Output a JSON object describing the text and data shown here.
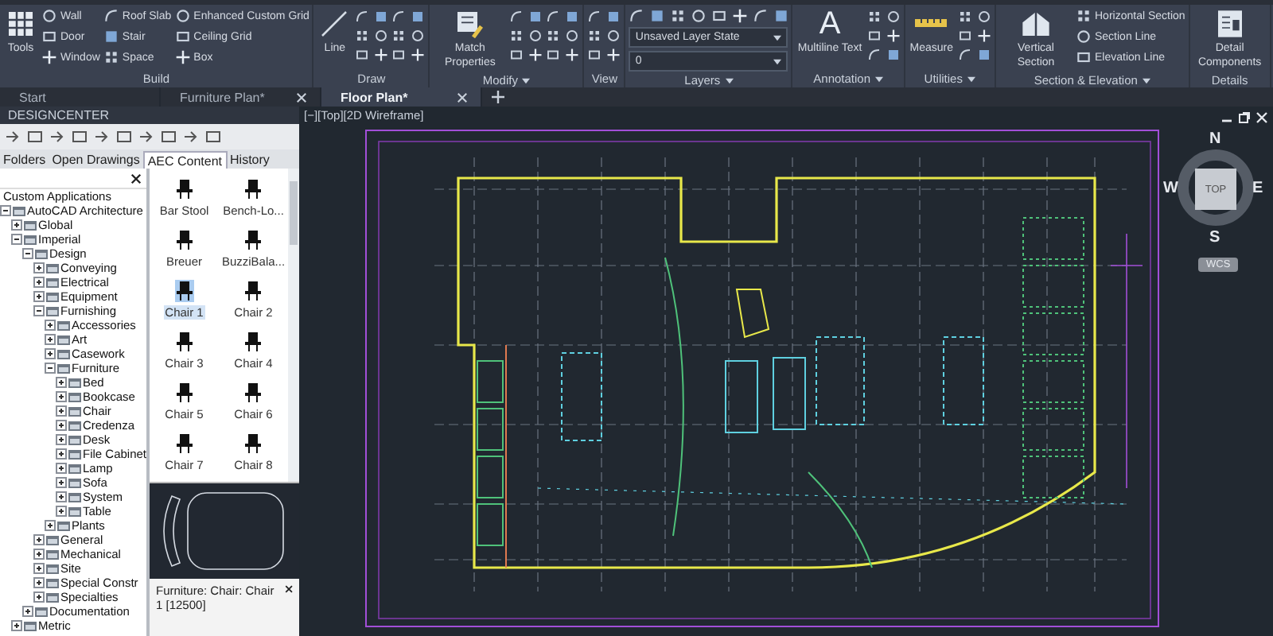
{
  "ribbon": {
    "panels": [
      {
        "title": "Build",
        "dropdown": false,
        "columns": [
          {
            "kind": "large",
            "label": "Tools"
          },
          {
            "kind": "list",
            "items": [
              "Wall",
              "Door",
              "Window"
            ]
          },
          {
            "kind": "list",
            "items": [
              "Roof Slab",
              "Stair",
              "Space"
            ]
          },
          {
            "kind": "list",
            "items": [
              "Enhanced Custom Grid",
              "Ceiling Grid",
              "Box"
            ]
          }
        ]
      },
      {
        "title": "Draw",
        "dropdown": false,
        "columns": [
          {
            "kind": "large",
            "label": "Line"
          },
          {
            "kind": "icons"
          },
          {
            "kind": "icons"
          }
        ]
      },
      {
        "title": "Modify",
        "dropdown": true,
        "columns": [
          {
            "kind": "large",
            "label": "Match Properties"
          },
          {
            "kind": "icons"
          },
          {
            "kind": "icons"
          }
        ]
      },
      {
        "title": "View",
        "dropdown": false,
        "columns": [
          {
            "kind": "icons"
          }
        ]
      },
      {
        "title": "Layers",
        "dropdown": true,
        "columns": [
          {
            "kind": "layers",
            "state": "Unsaved Layer State",
            "layer": "0"
          }
        ]
      },
      {
        "title": "Annotation",
        "dropdown": true,
        "columns": [
          {
            "kind": "large",
            "label": "Multiline Text",
            "glyph": "A"
          },
          {
            "kind": "icons"
          }
        ]
      },
      {
        "title": "Utilities",
        "dropdown": true,
        "columns": [
          {
            "kind": "large",
            "label": "Measure"
          },
          {
            "kind": "icons"
          }
        ]
      },
      {
        "title": "Section & Elevation",
        "dropdown": true,
        "columns": [
          {
            "kind": "large",
            "label": "Vertical Section"
          },
          {
            "kind": "list",
            "items": [
              "Horizontal Section",
              "Section Line",
              "Elevation Line"
            ]
          }
        ]
      },
      {
        "title": "Details",
        "dropdown": false,
        "columns": [
          {
            "kind": "large",
            "label": "Detail Components"
          }
        ]
      }
    ]
  },
  "file_tabs": [
    {
      "label": "Start",
      "selected": false,
      "closable": false
    },
    {
      "label": "Furniture Plan*",
      "selected": false,
      "closable": true
    },
    {
      "label": "Floor Plan*",
      "selected": true,
      "closable": true
    }
  ],
  "designcenter": {
    "title": "DESIGNCENTER",
    "tabs": [
      {
        "label": "Folders",
        "selected": false
      },
      {
        "label": "Open Drawings",
        "selected": false
      },
      {
        "label": "AEC Content",
        "selected": true
      },
      {
        "label": "History",
        "selected": false
      }
    ],
    "tree": {
      "title": "Custom Applications",
      "nodes": [
        {
          "label": "AutoCAD Architecture",
          "expanded": true,
          "children": [
            {
              "label": "Global",
              "expanded": false
            },
            {
              "label": "Imperial",
              "expanded": true,
              "children": [
                {
                  "label": "Design",
                  "expanded": true,
                  "children": [
                    {
                      "label": "Conveying",
                      "expanded": false
                    },
                    {
                      "label": "Electrical",
                      "expanded": false
                    },
                    {
                      "label": "Equipment",
                      "expanded": false
                    },
                    {
                      "label": "Furnishing",
                      "expanded": true,
                      "children": [
                        {
                          "label": "Accessories",
                          "expanded": false
                        },
                        {
                          "label": "Art",
                          "expanded": false
                        },
                        {
                          "label": "Casework",
                          "expanded": false
                        },
                        {
                          "label": "Furniture",
                          "expanded": true,
                          "children": [
                            {
                              "label": "Bed",
                              "expanded": false
                            },
                            {
                              "label": "Bookcase",
                              "expanded": false
                            },
                            {
                              "label": "Chair",
                              "expanded": false
                            },
                            {
                              "label": "Credenza",
                              "expanded": false
                            },
                            {
                              "label": "Desk",
                              "expanded": false
                            },
                            {
                              "label": "File Cabinet",
                              "expanded": false
                            },
                            {
                              "label": "Lamp",
                              "expanded": false
                            },
                            {
                              "label": "Sofa",
                              "expanded": false
                            },
                            {
                              "label": "System",
                              "expanded": false
                            },
                            {
                              "label": "Table",
                              "expanded": false
                            }
                          ]
                        },
                        {
                          "label": "Plants",
                          "expanded": false
                        }
                      ]
                    },
                    {
                      "label": "General",
                      "expanded": false
                    },
                    {
                      "label": "Mechanical",
                      "expanded": false
                    },
                    {
                      "label": "Site",
                      "expanded": false
                    },
                    {
                      "label": "Special Constr",
                      "expanded": false
                    },
                    {
                      "label": "Specialties",
                      "expanded": false
                    }
                  ]
                },
                {
                  "label": "Documentation",
                  "expanded": false
                }
              ]
            },
            {
              "label": "Metric",
              "expanded": false
            }
          ]
        }
      ]
    },
    "items": [
      {
        "label": "Bar Stool",
        "selected": false
      },
      {
        "label": "Bench-Lo...",
        "selected": false
      },
      {
        "label": "Breuer",
        "selected": false
      },
      {
        "label": "BuzziBala...",
        "selected": false
      },
      {
        "label": "Chair 1",
        "selected": true
      },
      {
        "label": "Chair 2",
        "selected": false
      },
      {
        "label": "Chair 3",
        "selected": false
      },
      {
        "label": "Chair 4",
        "selected": false
      },
      {
        "label": "Chair 5",
        "selected": false
      },
      {
        "label": "Chair 6",
        "selected": false
      },
      {
        "label": "Chair 7",
        "selected": false
      },
      {
        "label": "Chair 8",
        "selected": false
      }
    ],
    "description": "Furniture: Chair: Chair 1 [12500]"
  },
  "viewport": {
    "label": "[−][Top][2D Wireframe]",
    "compass": {
      "north": "N",
      "south": "S",
      "east": "E",
      "west": "W",
      "center": "TOP"
    },
    "ucs": "WCS"
  }
}
